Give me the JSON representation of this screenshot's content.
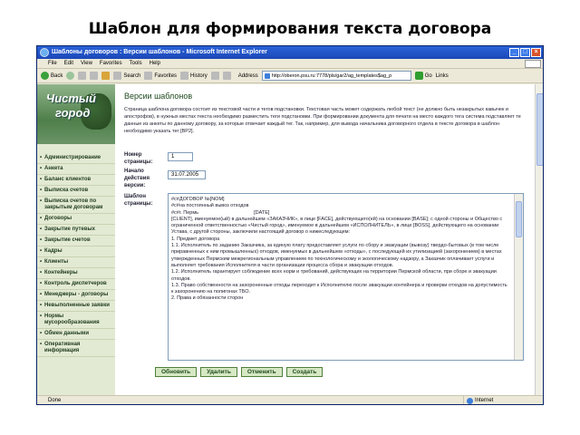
{
  "slide": {
    "title": "Шаблон для формирования текста договора"
  },
  "window": {
    "title": "Шаблоны договоров : Версии шаблонов - Microsoft Internet Explorer",
    "menu": [
      "File",
      "Edit",
      "View",
      "Favorites",
      "Tools",
      "Help"
    ],
    "toolbar": {
      "back": "Back",
      "search": "Search",
      "favorites": "Favorites",
      "history": "History",
      "address_label": "Address",
      "address": "http://oberon.psu.ru:7778/pls/gar2/ag_templates$ag_p",
      "go": "Go",
      "links": "Links"
    },
    "status": {
      "left": "Done",
      "zone": "Internet"
    }
  },
  "sidebar": {
    "logo_line1": "Чистый",
    "logo_line2": "город",
    "items": [
      "Администрирование",
      "Анкета",
      "Баланс клиентов",
      "Выписка счетов",
      "Выписка счетов по закрытым договорам",
      "Договоры",
      "Закрытие путевых",
      "Закрытие счетов",
      "Кадры",
      "Клиенты",
      "Контейнеры",
      "Контроль диспетчеров",
      "Менеджеры - договоры",
      "Невыполненные заявки",
      "Нормы мусорообразования",
      "Обмен данными",
      "Оперативная информация"
    ]
  },
  "main": {
    "heading": "Версии шаблонов",
    "intro": "Страница шаблона договора состоит из текстовой части и тегов подстановки. Текстовая часть может содержать любой текст (не должно быть незакрытых кавычек и апострофов), в нужных местах текста необходимо разместить теги подстановки. При формировании документа для печати на место каждого тега система подставляет те данные из анкеты по данному договору, за которые отвечает каждый тег. Так, например, для вывода начальника договорного отдела в тексте договора в шаблон необходимо указать тег [BP2].",
    "page_no_label": "Номер страницы:",
    "page_no": "1",
    "start_label": "Начало действия версии:",
    "start_date": "31.07.2005",
    "template_label": "Шаблон страницы:",
    "template_lines": [
      "#с#ДОГОВОР №[NOM]",
      "#с#на постоянный вывоз отходов",
      "#с#г. Пермь                                        [DATE]",
      "",
      "[CLIENT], именуемое(ый) в дальнейшем «ЗАКАЗЧИК», в лице [FACE], действующего(ей) на основании [BASE]; с одной стороны и Общество с ограниченной ответственностью «Чистый город», именуемое в дальнейшем «ИСПОЛНИТЕЛЬ», в лице [BOSS], действующего на основании Устава, с другой стороны, заключили настоящий договор о нижеследующем:",
      "",
      "1. Предмет договора",
      "1.1. Исполнитель по заданию Заказчика, за единую плату предоставляет услуги по сбору и эвакуации (вывозу) твердо-бытовых (в том числе приравненных к ним промышленных) отходов, именуемых в дальнейшем «отходы», с последующей их утилизацией (захоронением) в местах утвержденных Пермским межрегиональным управлением по технологическому и экологическому надзору, а Заказчик оплачивает услуги и выполняет требования Исполнителя в части организации процесса сбора и эвакуации отходов.",
      "1.2. Исполнитель гарантирует соблюдение всех норм и требований, действующих на территории Пермской области, при сборе и эвакуации отходов.",
      "1.3. Право собственности на захороненные отходы переходит к Исполнителю после эвакуации контейнера и проверки отходов на допустимость к захоронению на полигонах ТБО.",
      "",
      "2. Права и обязанности сторон"
    ],
    "buttons": {
      "update": "Обновить",
      "delete": "Удалить",
      "cancel": "Отменить",
      "create": "Создать"
    }
  }
}
